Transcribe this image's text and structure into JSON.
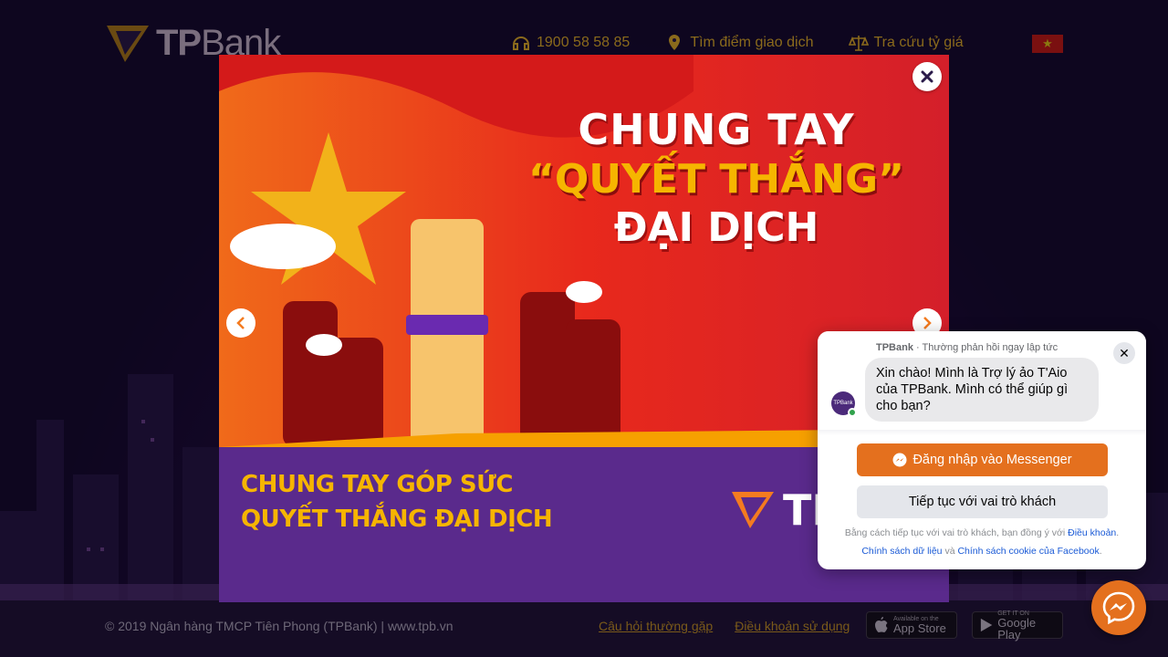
{
  "header": {
    "brand": {
      "tp": "TP",
      "bank": "Bank"
    },
    "hotline": "1900 58 58 85",
    "find_branch": "Tìm điểm giao dịch",
    "exchange_rate": "Tra cứu tỷ giá",
    "language_flag": "vn-flag-icon"
  },
  "banner": {
    "headline_1": "CHUNG TAY",
    "headline_2": "“QUYẾT THẮNG”",
    "headline_3": "ĐẠI DỊCH",
    "sub_title_1": "CHUNG TAY GÓP SỨC",
    "sub_title_2": "QUYẾT THẮNG ĐẠI DỊCH",
    "sub_desc": "",
    "logo_text": "TP",
    "close_icon": "close-icon",
    "prev_icon": "chevron-left-icon",
    "next_icon": "chevron-right-icon",
    "colors": {
      "red": "#e8291c",
      "orange": "#f47b20",
      "purple": "#5a2a8c",
      "gold": "#f6b500"
    }
  },
  "messenger": {
    "page_name": "TPBank",
    "response_note": "Thường phản hồi ngay lập tức",
    "greeting": "Xin chào! Mình là Trợ lý ảo T'Aio của TPBank. Mình có thể giúp gì cho bạn?",
    "login_button": "Đăng nhập vào Messenger",
    "guest_button": "Tiếp tục với vai trò khách",
    "terms_prefix": "Bằng cách tiếp tục với vai trò khách, bạn đồng ý với",
    "terms_link": "Điều khoản",
    "privacy_link": "Chính sách dữ liệu",
    "and": "và",
    "cookie_link": "Chính sách cookie của Facebook",
    "accent": "#e4701e"
  },
  "footer": {
    "copyright": "© 2019 Ngân hàng TMCP Tiên Phong (TPBank) | www.tpb.vn",
    "faq": "Câu hỏi thường gặp",
    "terms": "Điều khoản sử dụng",
    "app_store_small": "Available on the",
    "app_store": "App Store",
    "google_play_small": "GET IT ON",
    "google_play": "Google Play"
  }
}
